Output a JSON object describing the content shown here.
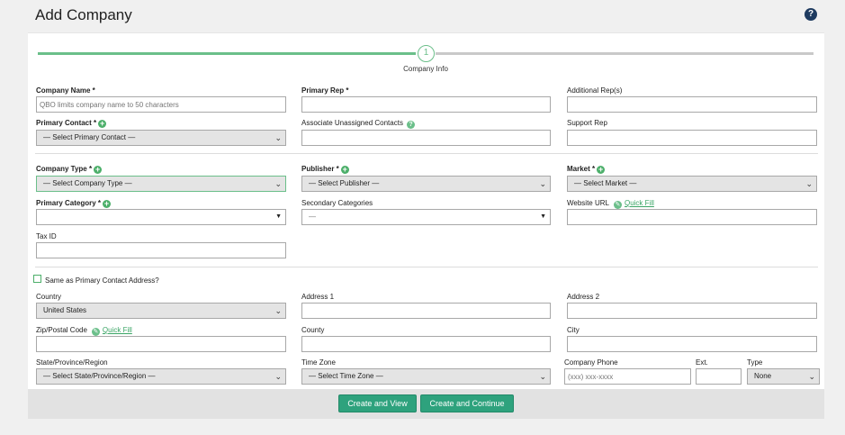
{
  "header": {
    "title": "Add Company",
    "help_icon": "?"
  },
  "stepper": {
    "step_number": "1",
    "step_label": "Company Info"
  },
  "fields": {
    "company_name": {
      "label": "Company Name *",
      "placeholder": "QBO limits company name to 50 characters"
    },
    "primary_rep": {
      "label": "Primary Rep *"
    },
    "additional_reps": {
      "label": "Additional Rep(s)"
    },
    "primary_contact": {
      "label": "Primary Contact *",
      "value": "— Select Primary Contact —"
    },
    "associate_unassigned": {
      "label": "Associate Unassigned Contacts"
    },
    "support_rep": {
      "label": "Support Rep"
    },
    "company_type": {
      "label": "Company Type *",
      "value": "— Select Company Type —"
    },
    "publisher": {
      "label": "Publisher *",
      "value": "— Select Publisher —"
    },
    "market": {
      "label": "Market *",
      "value": "— Select Market —"
    },
    "primary_category": {
      "label": "Primary Category *",
      "value": ""
    },
    "secondary_categories": {
      "label": "Secondary Categories",
      "value": "—"
    },
    "website_url": {
      "label": "Website URL",
      "quick_fill": "Quick Fill"
    },
    "tax_id": {
      "label": "Tax ID"
    },
    "same_as_primary": {
      "label": "Same as Primary Contact Address?"
    },
    "country": {
      "label": "Country",
      "value": "United States"
    },
    "address1": {
      "label": "Address 1"
    },
    "address2": {
      "label": "Address 2"
    },
    "zip": {
      "label": "Zip/Postal Code",
      "quick_fill": "Quick Fill"
    },
    "county": {
      "label": "County"
    },
    "city": {
      "label": "City"
    },
    "state": {
      "label": "State/Province/Region",
      "value": "— Select State/Province/Region —"
    },
    "time_zone": {
      "label": "Time Zone",
      "value": "— Select Time Zone —"
    },
    "company_phone": {
      "label": "Company Phone",
      "placeholder": "(xxx) xxx-xxxx"
    },
    "ext": {
      "label": "Ext."
    },
    "phone_type": {
      "label": "Type",
      "value": "None"
    }
  },
  "footer": {
    "create_view": "Create and View",
    "create_continue": "Create and Continue"
  },
  "colors": {
    "accent": "#2ea27d",
    "progress": "#6bbf8a",
    "help": "#1e3a5f"
  }
}
